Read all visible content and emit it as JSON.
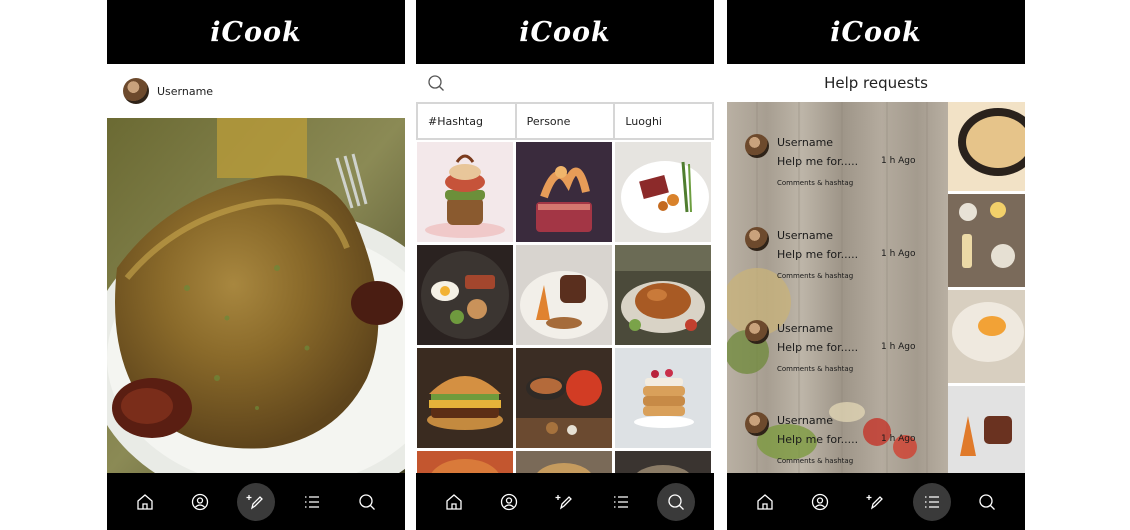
{
  "app": {
    "name": "iCook"
  },
  "nav": [
    {
      "name": "home-icon"
    },
    {
      "name": "profile-icon"
    },
    {
      "name": "new-post-icon"
    },
    {
      "name": "list-icon"
    },
    {
      "name": "search-icon"
    }
  ],
  "feed": {
    "username": "Username",
    "post_image": "crumbed cutlet with dried tomatoes on a white plate"
  },
  "explore": {
    "tabs": [
      "#Hashtag",
      "Persone",
      "Luoghi"
    ]
  },
  "help": {
    "title": "Help requests",
    "requests": [
      {
        "username": "Username",
        "message": "Help me for.....",
        "time": "1 h Ago",
        "meta": "Comments & hashtag"
      },
      {
        "username": "Username",
        "message": "Help me for.....",
        "time": "1 h Ago",
        "meta": "Comments & hashtag"
      },
      {
        "username": "Username",
        "message": "Help me for.....",
        "time": "1 h Ago",
        "meta": "Comments & hashtag"
      },
      {
        "username": "Username",
        "message": "Help me for.....",
        "time": "1 h Ago",
        "meta": "Comments & hashtag"
      }
    ]
  },
  "colors": {
    "bar": "#000000",
    "active_nav": "#3a3a3a",
    "tab_border": "#d6d6d6"
  }
}
